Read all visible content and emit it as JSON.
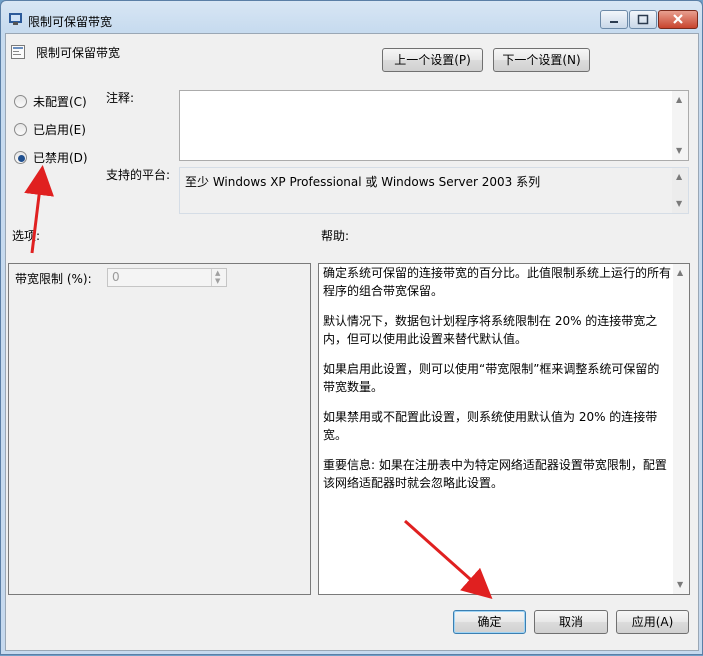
{
  "window": {
    "title": "限制可保留带宽",
    "policy_name": "限制可保留带宽"
  },
  "nav": {
    "prev_label": "上一个设置(P)",
    "next_label": "下一个设置(N)"
  },
  "state": {
    "options": [
      {
        "label": "未配置(C)",
        "checked": false
      },
      {
        "label": "已启用(E)",
        "checked": false
      },
      {
        "label": "已禁用(D)",
        "checked": true
      }
    ]
  },
  "comment": {
    "label": "注释:",
    "value": ""
  },
  "platform": {
    "label": "支持的平台:",
    "value": "至少 Windows XP Professional 或 Windows Server 2003 系列"
  },
  "options_section": {
    "label": "选项:",
    "bandwidth_label": "带宽限制 (%):",
    "bandwidth_value": "0"
  },
  "help": {
    "label": "帮助:",
    "paragraphs": [
      "确定系统可保留的连接带宽的百分比。此值限制系统上运行的所有程序的组合带宽保留。",
      "默认情况下，数据包计划程序将系统限制在 20% 的连接带宽之内，但可以使用此设置来替代默认值。",
      "如果启用此设置，则可以使用“带宽限制”框来调整系统可保留的带宽数量。",
      "如果禁用或不配置此设置，则系统使用默认值为 20% 的连接带宽。",
      "重要信息: 如果在注册表中为特定网络适配器设置带宽限制，配置该网络适配器时就会忽略此设置。"
    ]
  },
  "footer": {
    "ok_label": "确定",
    "cancel_label": "取消",
    "apply_label": "应用(A)"
  },
  "colors": {
    "annotation_arrow": "#e02020",
    "radio_selected": "#1f4f8f"
  }
}
